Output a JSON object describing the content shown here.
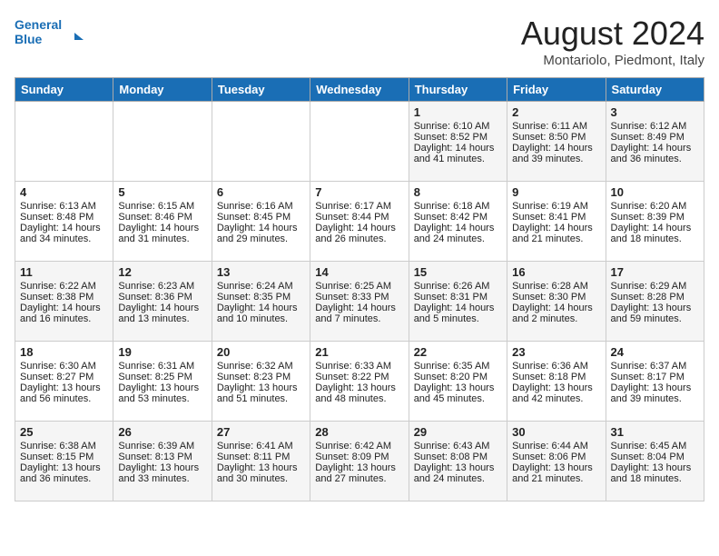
{
  "header": {
    "logo_line1": "General",
    "logo_line2": "Blue",
    "month_title": "August 2024",
    "location": "Montariolo, Piedmont, Italy"
  },
  "days_of_week": [
    "Sunday",
    "Monday",
    "Tuesday",
    "Wednesday",
    "Thursday",
    "Friday",
    "Saturday"
  ],
  "weeks": [
    [
      {
        "day": "",
        "sunrise": "",
        "sunset": "",
        "daylight": ""
      },
      {
        "day": "",
        "sunrise": "",
        "sunset": "",
        "daylight": ""
      },
      {
        "day": "",
        "sunrise": "",
        "sunset": "",
        "daylight": ""
      },
      {
        "day": "",
        "sunrise": "",
        "sunset": "",
        "daylight": ""
      },
      {
        "day": "1",
        "sunrise": "Sunrise: 6:10 AM",
        "sunset": "Sunset: 8:52 PM",
        "daylight": "Daylight: 14 hours and 41 minutes."
      },
      {
        "day": "2",
        "sunrise": "Sunrise: 6:11 AM",
        "sunset": "Sunset: 8:50 PM",
        "daylight": "Daylight: 14 hours and 39 minutes."
      },
      {
        "day": "3",
        "sunrise": "Sunrise: 6:12 AM",
        "sunset": "Sunset: 8:49 PM",
        "daylight": "Daylight: 14 hours and 36 minutes."
      }
    ],
    [
      {
        "day": "4",
        "sunrise": "Sunrise: 6:13 AM",
        "sunset": "Sunset: 8:48 PM",
        "daylight": "Daylight: 14 hours and 34 minutes."
      },
      {
        "day": "5",
        "sunrise": "Sunrise: 6:15 AM",
        "sunset": "Sunset: 8:46 PM",
        "daylight": "Daylight: 14 hours and 31 minutes."
      },
      {
        "day": "6",
        "sunrise": "Sunrise: 6:16 AM",
        "sunset": "Sunset: 8:45 PM",
        "daylight": "Daylight: 14 hours and 29 minutes."
      },
      {
        "day": "7",
        "sunrise": "Sunrise: 6:17 AM",
        "sunset": "Sunset: 8:44 PM",
        "daylight": "Daylight: 14 hours and 26 minutes."
      },
      {
        "day": "8",
        "sunrise": "Sunrise: 6:18 AM",
        "sunset": "Sunset: 8:42 PM",
        "daylight": "Daylight: 14 hours and 24 minutes."
      },
      {
        "day": "9",
        "sunrise": "Sunrise: 6:19 AM",
        "sunset": "Sunset: 8:41 PM",
        "daylight": "Daylight: 14 hours and 21 minutes."
      },
      {
        "day": "10",
        "sunrise": "Sunrise: 6:20 AM",
        "sunset": "Sunset: 8:39 PM",
        "daylight": "Daylight: 14 hours and 18 minutes."
      }
    ],
    [
      {
        "day": "11",
        "sunrise": "Sunrise: 6:22 AM",
        "sunset": "Sunset: 8:38 PM",
        "daylight": "Daylight: 14 hours and 16 minutes."
      },
      {
        "day": "12",
        "sunrise": "Sunrise: 6:23 AM",
        "sunset": "Sunset: 8:36 PM",
        "daylight": "Daylight: 14 hours and 13 minutes."
      },
      {
        "day": "13",
        "sunrise": "Sunrise: 6:24 AM",
        "sunset": "Sunset: 8:35 PM",
        "daylight": "Daylight: 14 hours and 10 minutes."
      },
      {
        "day": "14",
        "sunrise": "Sunrise: 6:25 AM",
        "sunset": "Sunset: 8:33 PM",
        "daylight": "Daylight: 14 hours and 7 minutes."
      },
      {
        "day": "15",
        "sunrise": "Sunrise: 6:26 AM",
        "sunset": "Sunset: 8:31 PM",
        "daylight": "Daylight: 14 hours and 5 minutes."
      },
      {
        "day": "16",
        "sunrise": "Sunrise: 6:28 AM",
        "sunset": "Sunset: 8:30 PM",
        "daylight": "Daylight: 14 hours and 2 minutes."
      },
      {
        "day": "17",
        "sunrise": "Sunrise: 6:29 AM",
        "sunset": "Sunset: 8:28 PM",
        "daylight": "Daylight: 13 hours and 59 minutes."
      }
    ],
    [
      {
        "day": "18",
        "sunrise": "Sunrise: 6:30 AM",
        "sunset": "Sunset: 8:27 PM",
        "daylight": "Daylight: 13 hours and 56 minutes."
      },
      {
        "day": "19",
        "sunrise": "Sunrise: 6:31 AM",
        "sunset": "Sunset: 8:25 PM",
        "daylight": "Daylight: 13 hours and 53 minutes."
      },
      {
        "day": "20",
        "sunrise": "Sunrise: 6:32 AM",
        "sunset": "Sunset: 8:23 PM",
        "daylight": "Daylight: 13 hours and 51 minutes."
      },
      {
        "day": "21",
        "sunrise": "Sunrise: 6:33 AM",
        "sunset": "Sunset: 8:22 PM",
        "daylight": "Daylight: 13 hours and 48 minutes."
      },
      {
        "day": "22",
        "sunrise": "Sunrise: 6:35 AM",
        "sunset": "Sunset: 8:20 PM",
        "daylight": "Daylight: 13 hours and 45 minutes."
      },
      {
        "day": "23",
        "sunrise": "Sunrise: 6:36 AM",
        "sunset": "Sunset: 8:18 PM",
        "daylight": "Daylight: 13 hours and 42 minutes."
      },
      {
        "day": "24",
        "sunrise": "Sunrise: 6:37 AM",
        "sunset": "Sunset: 8:17 PM",
        "daylight": "Daylight: 13 hours and 39 minutes."
      }
    ],
    [
      {
        "day": "25",
        "sunrise": "Sunrise: 6:38 AM",
        "sunset": "Sunset: 8:15 PM",
        "daylight": "Daylight: 13 hours and 36 minutes."
      },
      {
        "day": "26",
        "sunrise": "Sunrise: 6:39 AM",
        "sunset": "Sunset: 8:13 PM",
        "daylight": "Daylight: 13 hours and 33 minutes."
      },
      {
        "day": "27",
        "sunrise": "Sunrise: 6:41 AM",
        "sunset": "Sunset: 8:11 PM",
        "daylight": "Daylight: 13 hours and 30 minutes."
      },
      {
        "day": "28",
        "sunrise": "Sunrise: 6:42 AM",
        "sunset": "Sunset: 8:09 PM",
        "daylight": "Daylight: 13 hours and 27 minutes."
      },
      {
        "day": "29",
        "sunrise": "Sunrise: 6:43 AM",
        "sunset": "Sunset: 8:08 PM",
        "daylight": "Daylight: 13 hours and 24 minutes."
      },
      {
        "day": "30",
        "sunrise": "Sunrise: 6:44 AM",
        "sunset": "Sunset: 8:06 PM",
        "daylight": "Daylight: 13 hours and 21 minutes."
      },
      {
        "day": "31",
        "sunrise": "Sunrise: 6:45 AM",
        "sunset": "Sunset: 8:04 PM",
        "daylight": "Daylight: 13 hours and 18 minutes."
      }
    ]
  ]
}
